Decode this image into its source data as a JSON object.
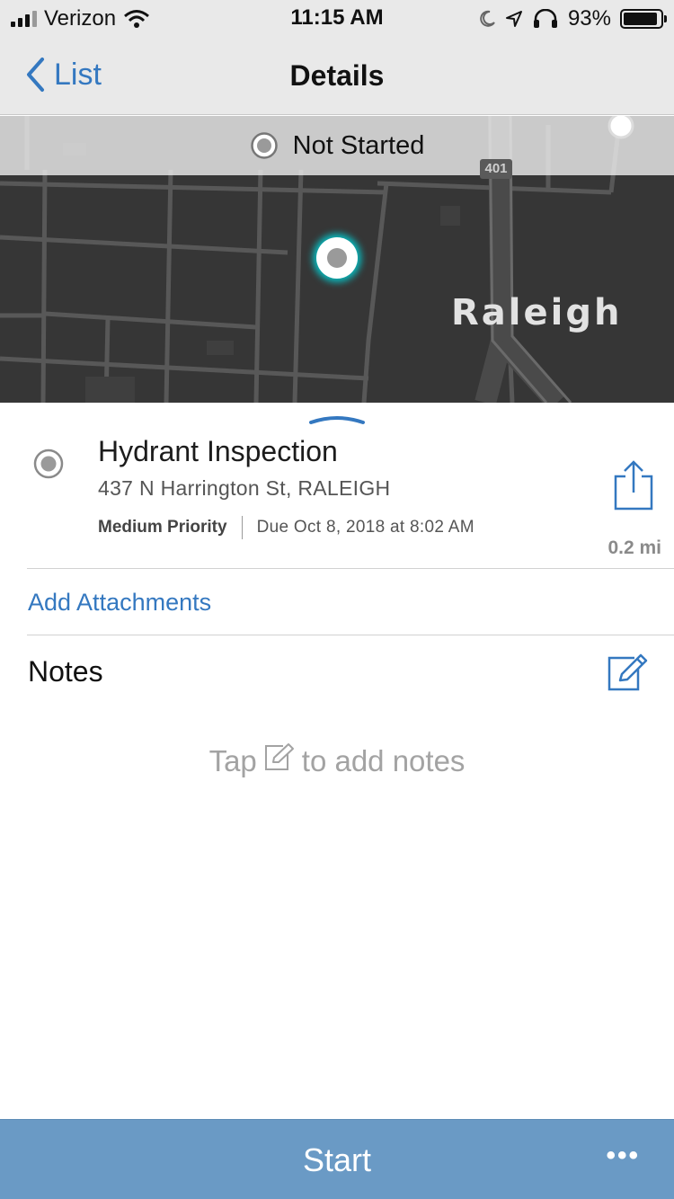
{
  "status_bar": {
    "carrier": "Verizon",
    "time": "11:15 AM",
    "battery_percent": "93%",
    "battery_level": 0.93,
    "icons": [
      "signal-icon",
      "wifi-icon",
      "moon-icon",
      "location-arrow-icon",
      "headphones-icon",
      "battery-icon"
    ]
  },
  "nav": {
    "back_label": "List",
    "title": "Details"
  },
  "map": {
    "status_label": "Not Started",
    "city_label": "Raleigh",
    "highway_label": "401",
    "marker_color": "#00d2d7"
  },
  "task": {
    "title": "Hydrant Inspection",
    "address": "437 N Harrington St, RALEIGH",
    "priority": "Medium Priority",
    "due": "Due Oct 8, 2018 at 8:02 AM",
    "distance": "0.2 mi"
  },
  "attachments": {
    "link_label": "Add Attachments"
  },
  "notes": {
    "heading": "Notes",
    "hint_before": "Tap",
    "hint_after": "to add notes"
  },
  "bottom_bar": {
    "primary_label": "Start",
    "more_label": "•••"
  },
  "colors": {
    "accent": "#3478c0",
    "bottom_bar": "#6a9ac5",
    "map_background": "#363636"
  }
}
